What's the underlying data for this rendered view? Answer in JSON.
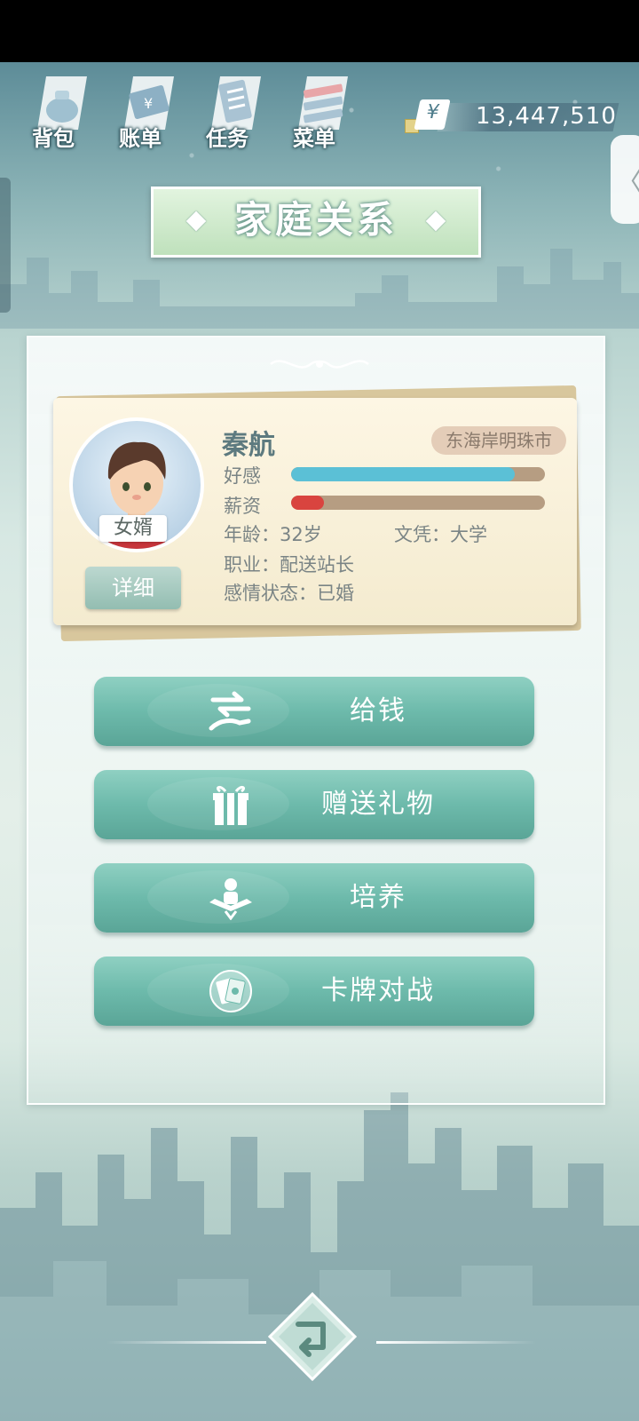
{
  "toolbar": {
    "items": [
      {
        "label": "背包",
        "icon": "bag-icon"
      },
      {
        "label": "账单",
        "icon": "bill-icon"
      },
      {
        "label": "任务",
        "icon": "task-icon"
      },
      {
        "label": "菜单",
        "icon": "menu-icon"
      }
    ],
    "currency_symbol": "¥",
    "money": "13,447,510"
  },
  "side_tab": {
    "glyph": "〈"
  },
  "page_title": "家庭关系",
  "person": {
    "name": "秦航",
    "location": "东海岸明珠市",
    "relation": "女婿",
    "detail_label": "详细",
    "favorability_label": "好感",
    "favorability_level": 0.88,
    "favorability_color": "#5bc0d6",
    "salary_label": "薪资",
    "salary_level": 0.13,
    "salary_color": "#d9443f",
    "age": "年龄：32岁",
    "education": "文凭：大学",
    "job": "职业：配送站长",
    "marital": "感情状态：已婚"
  },
  "actions": [
    {
      "label": "给钱",
      "icon": "transfer-money-icon"
    },
    {
      "label": "赠送礼物",
      "icon": "gift-icon"
    },
    {
      "label": "培养",
      "icon": "study-icon"
    },
    {
      "label": "卡牌对战",
      "icon": "cards-icon"
    }
  ],
  "back_icon": "back-icon"
}
